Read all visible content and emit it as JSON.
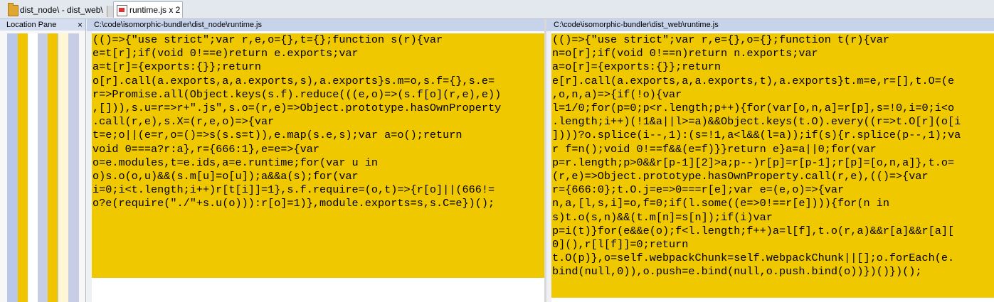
{
  "tabs": [
    {
      "label": "dist_node\\ - dist_web\\",
      "icon": "folder-compare-icon"
    },
    {
      "label": "runtime.js x 2",
      "icon": "text-compare-icon"
    }
  ],
  "location_pane": {
    "title": "Location Pane",
    "close": "×"
  },
  "left": {
    "path": "C:\\code\\isomorphic-bundler\\dist_node\\runtime.js",
    "lines": [
      "(()=>{\"use strict\";var r,e,o={},t={};function s(r){var",
      "e=t[r];if(void 0!==e)return e.exports;var",
      "a=t[r]={exports:{}};return",
      "o[r].call(a.exports,a,a.exports,s),a.exports}s.m=o,s.f={},s.e=",
      "r=>Promise.all(Object.keys(s.f).reduce(((e,o)=>(s.f[o](r,e),e))",
      ",[])),s.u=r=>r+\".js\",s.o=(r,e)=>Object.prototype.hasOwnProperty",
      ".call(r,e),s.X=(r,e,o)=>{var",
      "t=e;o||(e=r,o=()=>s(s.s=t)),e.map(s.e,s);var a=o();return",
      "void 0===a?r:a},r={666:1},e=e=>{var",
      "o=e.modules,t=e.ids,a=e.runtime;for(var u in",
      "o)s.o(o,u)&&(s.m[u]=o[u]);a&&a(s);for(var",
      "i=0;i<t.length;i++)r[t[i]]=1},s.f.require=(o,t)=>{r[o]||(666!=",
      "o?e(require(\"./\"+s.u(o))):r[o]=1)},module.exports=s,s.C=e})();"
    ]
  },
  "right": {
    "path": "C:\\code\\isomorphic-bundler\\dist_web\\runtime.js",
    "lines": [
      "(()=>{\"use strict\";var r,e={},o={};function t(r){var",
      "n=o[r];if(void 0!==n)return n.exports;var",
      "a=o[r]={exports:{}};return",
      "e[r].call(a.exports,a,a.exports,t),a.exports}t.m=e,r=[],t.O=(e",
      ",o,n,a)=>{if(!o){var",
      "l=1/0;for(p=0;p<r.length;p++){for(var[o,n,a]=r[p],s=!0,i=0;i<o",
      ".length;i++)(!1&a||l>=a)&&Object.keys(t.O).every((r=>t.O[r](o[i",
      "])))?o.splice(i--,1):(s=!1,a<l&&(l=a));if(s){r.splice(p--,1);va",
      "r f=n();void 0!==f&&(e=f)}}return e}a=a||0;for(var",
      "p=r.length;p>0&&r[p-1][2]>a;p--)r[p]=r[p-1];r[p]=[o,n,a]},t.o=",
      "(r,e)=>Object.prototype.hasOwnProperty.call(r,e),(()=>{var",
      "r={666:0};t.O.j=e=>0===r[e];var e=(e,o)=>{var",
      "n,a,[l,s,i]=o,f=0;if(l.some((e=>0!==r[e]))){for(n in",
      "s)t.o(s,n)&&(t.m[n]=s[n]);if(i)var",
      "p=i(t)}for(e&&e(o);f<l.length;f++)a=l[f],t.o(r,a)&&r[a]&&r[a][",
      "0](),r[l[f]]=0;return",
      "t.O(p)},o=self.webpackChunk=self.webpackChunk||[];o.forEach(e.",
      "bind(null,0)),o.push=e.bind(null,o.push.bind(o))})()})();"
    ]
  }
}
